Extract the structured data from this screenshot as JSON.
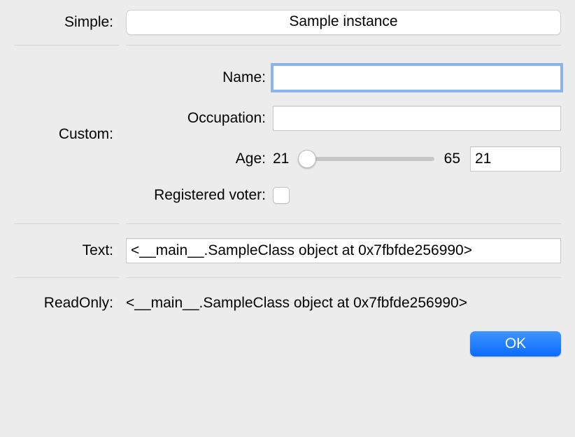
{
  "simple": {
    "label": "Simple:",
    "button_label": "Sample instance"
  },
  "custom": {
    "label": "Custom:",
    "fields": {
      "name": {
        "label": "Name:",
        "value": ""
      },
      "occupation": {
        "label": "Occupation:",
        "value": ""
      },
      "age": {
        "label": "Age:",
        "min": 21,
        "min_label": "21",
        "max": 65,
        "max_label": "65",
        "value": 21,
        "value_label": "21"
      },
      "registered_voter": {
        "label": "Registered voter:",
        "checked": false
      }
    }
  },
  "text": {
    "label": "Text:",
    "value": "<__main__.SampleClass object at 0x7fbfde256990>"
  },
  "readonly": {
    "label": "ReadOnly:",
    "value": "<__main__.SampleClass object at 0x7fbfde256990>"
  },
  "buttons": {
    "ok": "OK"
  }
}
